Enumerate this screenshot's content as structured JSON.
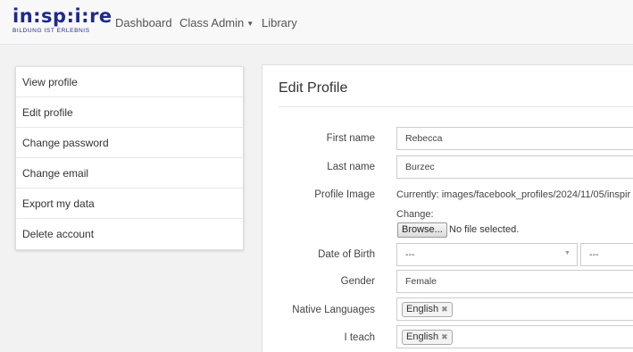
{
  "brand": {
    "name": "in:sp:i:re",
    "tagline": "BILDUNG IST ERLEBNIS"
  },
  "nav": {
    "items": [
      {
        "label": "Dashboard"
      },
      {
        "label": "Class Admin",
        "icon": "caret-down-icon"
      },
      {
        "label": "Library"
      }
    ]
  },
  "sidebar": {
    "items": [
      {
        "label": "View profile"
      },
      {
        "label": "Edit profile"
      },
      {
        "label": "Change password"
      },
      {
        "label": "Change email"
      },
      {
        "label": "Export my data"
      },
      {
        "label": "Delete account"
      }
    ]
  },
  "form": {
    "title": "Edit Profile",
    "first_name": {
      "label": "First name",
      "value": "Rebecca"
    },
    "last_name": {
      "label": "Last name",
      "value": "Burzec"
    },
    "profile_image": {
      "label": "Profile Image",
      "current": "Currently: images/facebook_profiles/2024/11/05/inspir",
      "change_label": "Change:",
      "browse_label": "Browse...",
      "file_status": "No file selected."
    },
    "dob": {
      "label": "Date of Birth",
      "day": "---",
      "month": "---"
    },
    "gender": {
      "label": "Gender",
      "value": "Female"
    },
    "native_languages": {
      "label": "Native Languages",
      "tags": [
        "English"
      ]
    },
    "i_teach": {
      "label": "I teach",
      "tags": [
        "English"
      ]
    }
  },
  "colors": {
    "brand": "#1f2a8a",
    "background": "#cfeef2"
  }
}
